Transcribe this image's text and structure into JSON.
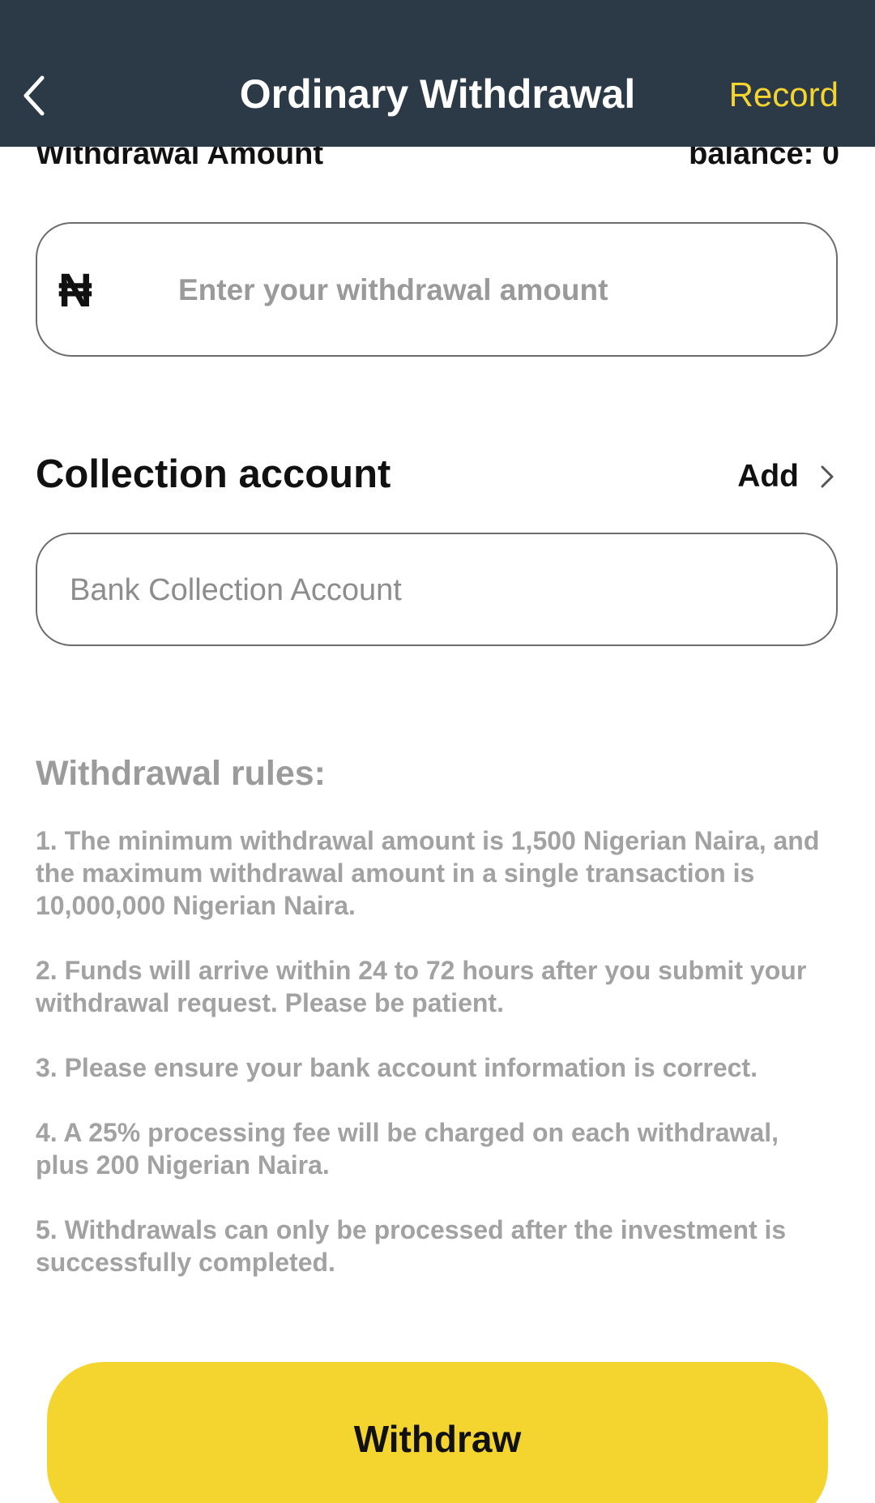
{
  "header": {
    "title": "Ordinary Withdrawal",
    "record_label": "Record",
    "back_icon": "chevron-left-icon",
    "background_color": "#2c3a48",
    "accent_color": "#f4d530"
  },
  "withdrawal_amount": {
    "label": "Withdrawal Amount",
    "balance_text": "balance: 0",
    "currency_symbol": "₦",
    "input_value": "",
    "input_placeholder": "Enter your withdrawal amount"
  },
  "collection_account": {
    "title": "Collection account",
    "add_label": "Add",
    "add_icon": "chevron-right-icon",
    "placeholder": "Bank Collection Account"
  },
  "rules": {
    "title": "Withdrawal rules:",
    "items": [
      "1. The minimum withdrawal amount is 1,500 Nigerian Naira, and the maximum withdrawal amount in a single transaction is 10,000,000 Nigerian Naira.",
      "2. Funds will arrive within 24 to 72 hours after you submit your withdrawal request. Please be patient.",
      "3. Please ensure your bank account information is correct.",
      "4. A 25% processing fee will be charged on each withdrawal, plus 200 Nigerian Naira.",
      "5. Withdrawals can only be processed after the investment is successfully completed."
    ]
  },
  "submit": {
    "label": "Withdraw",
    "color": "#f4d52f"
  }
}
